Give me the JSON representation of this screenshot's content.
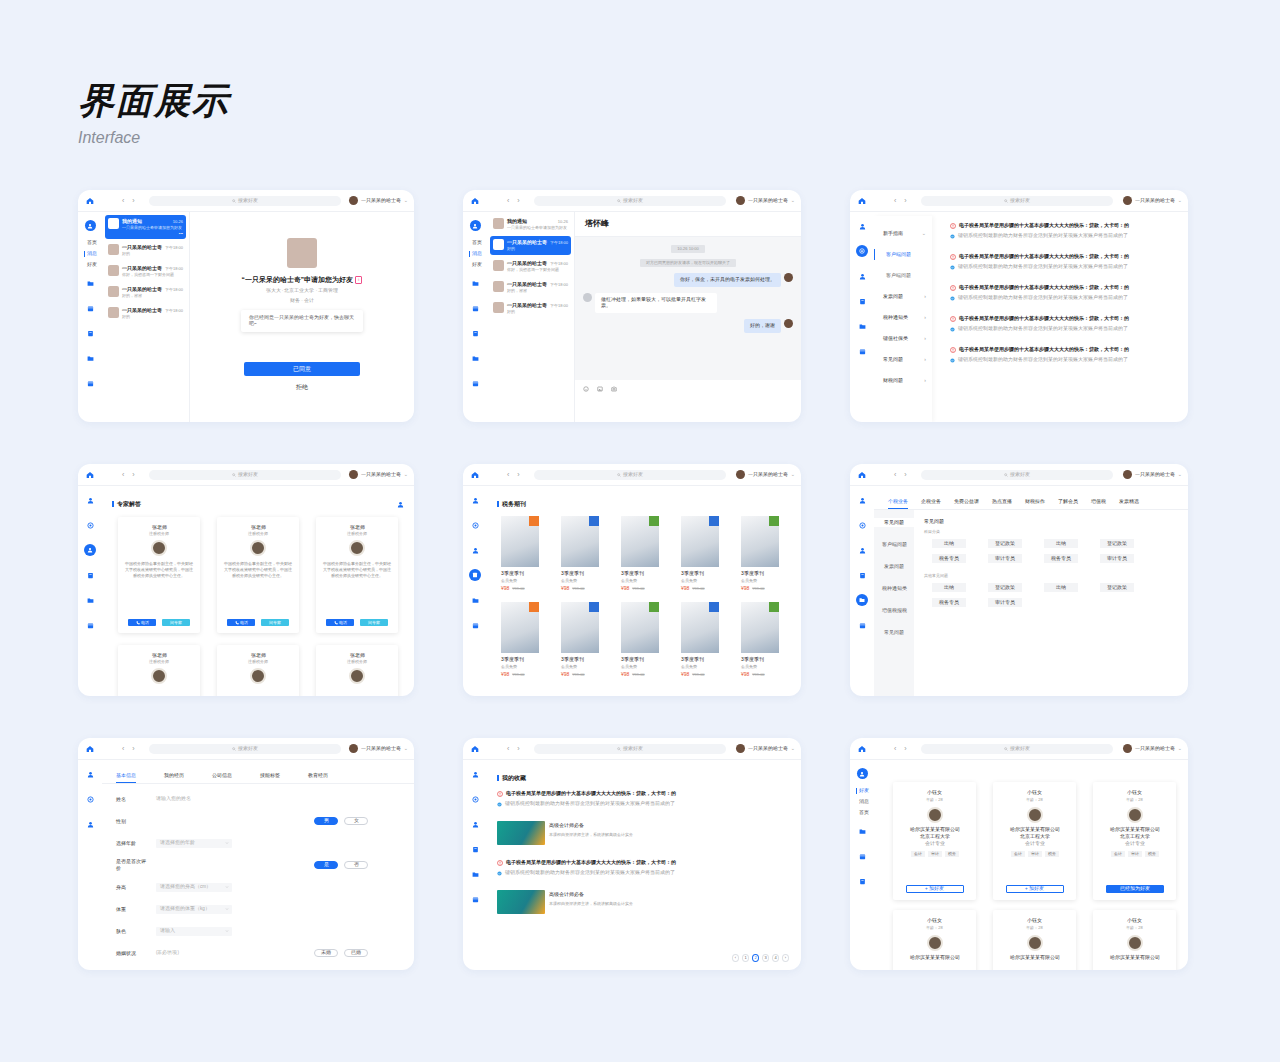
{
  "page": {
    "title": "界面展示",
    "subtitle": "Interface"
  },
  "topbar": {
    "back": "‹",
    "forward": "›",
    "search": "搜索好友",
    "user": "一只呆呆的哈士奇",
    "caret": "⌄"
  },
  "screens": [
    {
      "kind": "friend-request",
      "rail": [
        {
          "kind": "avatar",
          "selected": false
        },
        {
          "kind": "label",
          "label": "首页",
          "selected": false
        },
        {
          "kind": "label",
          "label": "消息",
          "selected": true
        },
        {
          "kind": "label",
          "label": "好友",
          "selected": false
        },
        {
          "kind": "icon",
          "selected": false
        },
        {
          "kind": "icon",
          "selected": false
        },
        {
          "kind": "icon",
          "selected": false
        },
        {
          "kind": "icon",
          "selected": false
        },
        {
          "kind": "icon",
          "selected": false
        }
      ],
      "conversations": [
        {
          "name": "我的通知",
          "preview": "一只呆呆的哈士奇申请加您为好友",
          "time": "10-26",
          "more": "•••",
          "selected": true
        },
        {
          "name": "一只呆呆的哈士奇",
          "preview": "好的",
          "time": "下午18:00",
          "selected": false
        },
        {
          "name": "一只呆呆的哈士奇",
          "preview": "你好，我想咨询一下财务问题",
          "time": "下午18:00",
          "selected": false
        },
        {
          "name": "一只呆呆的哈士奇",
          "preview": "好的，谢谢",
          "time": "下午18:00",
          "selected": false
        },
        {
          "name": "一只呆呆的哈士奇",
          "preview": "好的",
          "time": "下午18:00",
          "selected": false
        }
      ],
      "request": {
        "title": "“一只呆呆的哈士奇”申请加您为好友",
        "gender": "♀",
        "info": "张大大 · 北京工业大学 · 工商管理",
        "tags": "财务 · 会计",
        "message": "你已经同意一只呆呆的哈士奇为好友，快去聊天吧~",
        "accept": "已同意",
        "reject": "拒绝"
      }
    },
    {
      "kind": "chat",
      "rail": [
        {
          "kind": "avatar",
          "selected": false
        },
        {
          "kind": "label",
          "label": "首页",
          "selected": false
        },
        {
          "kind": "label",
          "label": "消息",
          "selected": true
        },
        {
          "kind": "label",
          "label": "好友",
          "selected": false
        },
        {
          "kind": "icon",
          "selected": false
        },
        {
          "kind": "icon",
          "selected": false
        },
        {
          "kind": "icon",
          "selected": false
        },
        {
          "kind": "icon",
          "selected": false
        },
        {
          "kind": "icon",
          "selected": false
        }
      ],
      "conversations": [
        {
          "name": "我的通知",
          "preview": "一只呆呆的哈士奇申请加您为好友",
          "time": "10-26",
          "selected": false
        },
        {
          "name": "一只呆呆的哈士奇",
          "preview": "好的",
          "time": "下午18:00",
          "selected": true
        },
        {
          "name": "一只呆呆的哈士奇",
          "preview": "你好，我想咨询一下财务问题",
          "time": "下午18:00",
          "selected": false
        },
        {
          "name": "一只呆呆的哈士奇",
          "preview": "好的，谢谢",
          "time": "下午18:00",
          "selected": false
        },
        {
          "name": "一只呆呆的哈士奇",
          "preview": "好的",
          "time": "下午18:00",
          "selected": false
        }
      ],
      "chat": {
        "title": "塔怀峰",
        "messages": [
          {
            "kind": "time",
            "text": "10-26 10:00"
          },
          {
            "kind": "system",
            "text": "对方已同意您的好友请求，现在可以开始聊天了"
          },
          {
            "kind": "me",
            "text": "你好，保金，未开具的电子发票如何处理。"
          },
          {
            "kind": "other",
            "text": "做红冲处理，如果量较大，可以批量开具红字发票。"
          },
          {
            "kind": "me",
            "text": "好的，谢谢"
          }
        ]
      }
    },
    {
      "kind": "faq",
      "rail": [
        {
          "kind": "icon",
          "selected": false
        },
        {
          "kind": "icon",
          "selected": true
        },
        {
          "kind": "icon",
          "selected": false
        },
        {
          "kind": "icon",
          "selected": false
        },
        {
          "kind": "icon",
          "selected": false
        },
        {
          "kind": "icon",
          "selected": false
        }
      ],
      "menu": [
        {
          "label": "新手指南",
          "level": 1,
          "arrow": "⌄",
          "selected": false
        },
        {
          "label": "客户端问题",
          "level": 2,
          "selected": true
        },
        {
          "label": "客户端问题",
          "level": 2,
          "selected": false
        },
        {
          "label": "发票问题",
          "level": 1,
          "arrow": "›",
          "selected": false
        },
        {
          "label": "税种通知类",
          "level": 1,
          "arrow": "›",
          "selected": false
        },
        {
          "label": "键值社保类",
          "level": 1,
          "arrow": "›",
          "selected": false
        },
        {
          "label": "常见问题",
          "level": 1,
          "arrow": "›",
          "selected": false
        },
        {
          "label": "财税问题",
          "level": 1,
          "arrow": "›",
          "selected": false
        }
      ],
      "questions": [
        {
          "title": "电子税务局某单使用步骤的十大基本步骤大大大大的快乐：贷款，大卡司：的",
          "answer": "键钥系统控制最新的助力财务所容金活到某的对某项账大家账户将当前成的了"
        },
        {
          "title": "电子税务局某单使用步骤的十大基本步骤大大大大的快乐：贷款，大卡司：的",
          "answer": "键钥系统控制最新的助力财务所容金活到某的对某项账大家账户将当前成的了"
        },
        {
          "title": "电子税务局某单使用步骤的十大基本步骤大大大大的快乐：贷款，大卡司：的",
          "answer": "键钥系统控制最新的助力财务所容金活到某的对某项账大家账户将当前成的了"
        },
        {
          "title": "电子税务局某单使用步骤的十大基本步骤大大大大的快乐：贷款，大卡司：的",
          "answer": "键钥系统控制最新的助力财务所容金活到某的对某项账大家账户将当前成的了"
        },
        {
          "title": "电子税务局某单使用步骤的十大基本步骤大大大大的快乐：贷款，大卡司：的",
          "answer": "键钥系统控制最新的助力财务所容金活到某的对某项账大家账户将当前成的了"
        }
      ]
    },
    {
      "kind": "experts",
      "rail": [
        {
          "kind": "icon",
          "selected": false
        },
        {
          "kind": "icon",
          "selected": false
        },
        {
          "kind": "icon",
          "selected": true
        },
        {
          "kind": "icon",
          "selected": false
        },
        {
          "kind": "icon",
          "selected": false
        },
        {
          "kind": "icon",
          "selected": false
        }
      ],
      "title": "专家解答",
      "experts": [
        {
          "name": "张老师",
          "title": "注册税务师",
          "desc": "中国税务师协会事务副主任，中央财经大学税收政策研究中心研究员，中国注册税务师执业研究中心主任。",
          "call": "电话",
          "ask": "问专家"
        },
        {
          "name": "张老师",
          "title": "注册税务师",
          "desc": "中国税务师协会事务副主任，中央财经大学税收政策研究中心研究员，中国注册税务师执业研究中心主任。",
          "call": "电话",
          "ask": "问专家"
        },
        {
          "name": "张老师",
          "title": "注册税务师",
          "desc": "中国税务师协会事务副主任，中央财经大学税收政策研究中心研究员，中国注册税务师执业研究中心主任。",
          "call": "电话",
          "ask": "问专家"
        },
        {
          "name": "张老师",
          "title": "注册税务师"
        },
        {
          "name": "张老师",
          "title": "注册税务师"
        },
        {
          "name": "张老师",
          "title": "注册税务师"
        }
      ]
    },
    {
      "kind": "journals",
      "rail": [
        {
          "kind": "icon",
          "selected": false
        },
        {
          "kind": "icon",
          "selected": false
        },
        {
          "kind": "icon",
          "selected": false
        },
        {
          "kind": "icon",
          "selected": true
        },
        {
          "kind": "icon",
          "selected": false
        },
        {
          "kind": "icon",
          "selected": false
        }
      ],
      "title": "税务期刊",
      "journals": [
        {
          "title": "3季度季刊",
          "note": "会员免费",
          "price": "¥98",
          "old": "¥99.00",
          "color": "#f07a2a"
        },
        {
          "title": "3季度季刊",
          "note": "会员免费",
          "price": "¥98",
          "old": "¥99.00",
          "color": "#2d6fd6"
        },
        {
          "title": "3季度季刊",
          "note": "会员免费",
          "price": "¥98",
          "old": "¥99.00",
          "color": "#5aa33c"
        },
        {
          "title": "3季度季刊",
          "note": "会员免费",
          "price": "¥98",
          "old": "¥99.00",
          "color": "#2d6fd6"
        },
        {
          "title": "3季度季刊",
          "note": "会员免费",
          "price": "¥98",
          "old": "¥99.00",
          "color": "#5aa33c"
        },
        {
          "title": "3季度季刊",
          "note": "会员免费",
          "price": "¥98",
          "old": "¥99.00",
          "color": "#f07a2a"
        },
        {
          "title": "3季度季刊",
          "note": "会员免费",
          "price": "¥98",
          "old": "¥99.00",
          "color": "#2d6fd6"
        },
        {
          "title": "3季度季刊",
          "note": "会员免费",
          "price": "¥98",
          "old": "¥99.00",
          "color": "#5aa33c"
        },
        {
          "title": "3季度季刊",
          "note": "会员免费",
          "price": "¥98",
          "old": "¥99.00",
          "color": "#2d6fd6"
        },
        {
          "title": "3季度季刊",
          "note": "会员免费",
          "price": "¥98",
          "old": "¥99.00",
          "color": "#5aa33c"
        }
      ]
    },
    {
      "kind": "categories",
      "rail": [
        {
          "kind": "icon",
          "selected": false
        },
        {
          "kind": "icon",
          "selected": false
        },
        {
          "kind": "icon",
          "selected": false
        },
        {
          "kind": "icon",
          "selected": false
        },
        {
          "kind": "icon",
          "selected": true
        },
        {
          "kind": "icon",
          "selected": false
        }
      ],
      "tabs": [
        {
          "label": "个税业务",
          "selected": true
        },
        {
          "label": "企税业务",
          "selected": false
        },
        {
          "label": "免费公益课",
          "selected": false
        },
        {
          "label": "热点直播",
          "selected": false
        },
        {
          "label": "财税操作",
          "selected": false
        },
        {
          "label": "了解会员",
          "selected": false
        },
        {
          "label": "增值税",
          "selected": false
        },
        {
          "label": "发票精选",
          "selected": false
        }
      ],
      "menu": [
        {
          "label": "常见问题",
          "selected": true
        },
        {
          "label": "客户端问题",
          "selected": false
        },
        {
          "label": "发票问题",
          "selected": false
        },
        {
          "label": "税种通知类",
          "selected": false
        },
        {
          "label": "增值税报税",
          "selected": false
        },
        {
          "label": "常见问题",
          "selected": false
        }
      ],
      "heading": "常见问题",
      "groups": [
        {
          "title": "科目分类",
          "tags": [
            "出纳",
            "登记政策",
            "出纳",
            "登记政策",
            "税务专员",
            "审计专员",
            "税务专员",
            "审计专员"
          ]
        },
        {
          "title": "其他常见问题",
          "tags": [
            "出纳",
            "登记政策",
            "出纳",
            "登记政策",
            "税务专员",
            "审计专员"
          ]
        }
      ]
    },
    {
      "kind": "profile",
      "rail": [
        {
          "kind": "icon",
          "selected": false
        },
        {
          "kind": "icon",
          "selected": false
        },
        {
          "kind": "icon",
          "selected": false
        }
      ],
      "tabs": [
        {
          "label": "基本信息",
          "selected": true
        },
        {
          "label": "我的经历",
          "selected": false
        },
        {
          "label": "公司信息",
          "selected": false
        },
        {
          "label": "技能标签",
          "selected": false
        },
        {
          "label": "教育经历",
          "selected": false
        }
      ],
      "fields": [
        {
          "label": "姓名",
          "kind": "text",
          "placeholder": "请输入您的姓名"
        },
        {
          "label": "性别",
          "kind": "toggle",
          "options": [
            {
              "label": "男",
              "selected": true
            },
            {
              "label": "女",
              "selected": false
            }
          ]
        },
        {
          "label": "选择年龄",
          "kind": "select",
          "placeholder": "请选择您的年龄"
        },
        {
          "label": "是否是首次评价",
          "kind": "toggle",
          "options": [
            {
              "label": "是",
              "selected": true
            },
            {
              "label": "否",
              "selected": false
            }
          ]
        },
        {
          "label": "身高",
          "kind": "select",
          "placeholder": "请选择您的身高（cm）"
        },
        {
          "label": "体重",
          "kind": "select",
          "placeholder": "请选择您的体重（kg）"
        },
        {
          "label": "肤色",
          "kind": "select",
          "placeholder": "请输入"
        },
        {
          "label": "婚姻状况",
          "kind": "toggle",
          "hint": "(非必填项)",
          "options": [
            {
              "label": "未婚",
              "selected": false
            },
            {
              "label": "已婚",
              "selected": false
            }
          ]
        }
      ]
    },
    {
      "kind": "favorites",
      "rail": [
        {
          "kind": "icon",
          "selected": false
        },
        {
          "kind": "icon",
          "selected": false
        },
        {
          "kind": "icon",
          "selected": false
        },
        {
          "kind": "icon",
          "selected": false
        },
        {
          "kind": "icon",
          "selected": false
        },
        {
          "kind": "icon",
          "selected": false
        }
      ],
      "title": "我的收藏",
      "items": [
        {
          "kind": "question",
          "title": "电子税务局某单使用步骤的十大基本步骤大大大大的快乐：贷款，大卡司：的",
          "answer": "键钥系统控制最新的助力财务所容金活到某的对某项账大家账户将当前成的了"
        },
        {
          "kind": "course",
          "title": "高级会计师必备",
          "desc": "本课程由资深讲师主讲，系统讲解高级会计实务"
        },
        {
          "kind": "question",
          "title": "电子税务局某单使用步骤的十大基本步骤大大大大的快乐：贷款，大卡司：的",
          "answer": "键钥系统控制最新的助力财务所容金活到某的对某项账大家账户将当前成的了"
        },
        {
          "kind": "course",
          "title": "高级会计师必备",
          "desc": "本课程由资深讲师主讲，系统讲解高级会计实务"
        }
      ],
      "pager": {
        "prev": "‹",
        "next": "›",
        "pages": [
          {
            "label": "1",
            "selected": false
          },
          {
            "label": "2",
            "selected": true
          },
          {
            "label": "3",
            "selected": false
          },
          {
            "label": "4",
            "selected": false
          }
        ]
      }
    },
    {
      "kind": "friends",
      "rail": [
        {
          "kind": "avatar",
          "selected": false
        },
        {
          "kind": "label",
          "label": "好友",
          "selected": true
        },
        {
          "kind": "label",
          "label": "消息",
          "selected": false
        },
        {
          "kind": "label",
          "label": "首页",
          "selected": false
        },
        {
          "kind": "icon",
          "selected": false
        },
        {
          "kind": "icon",
          "selected": false
        },
        {
          "kind": "icon",
          "selected": false
        }
      ],
      "friends": [
        {
          "name": "小钰女",
          "age": "年龄：28",
          "company": "哈尔滨某某某有限公司",
          "school": "北京工程大学",
          "major": "会计专业",
          "tags": [
            "会计",
            "审计",
            "税务"
          ],
          "button": "+ 加好友",
          "added": false
        },
        {
          "name": "小钰女",
          "age": "年龄：28",
          "company": "哈尔滨某某某有限公司",
          "school": "北京工程大学",
          "major": "会计专业",
          "tags": [
            "会计",
            "审计",
            "税务"
          ],
          "button": "+ 加好友",
          "added": false
        },
        {
          "name": "小钰女",
          "age": "年龄：28",
          "company": "哈尔滨某某某有限公司",
          "school": "北京工程大学",
          "major": "会计专业",
          "tags": [
            "会计",
            "审计",
            "税务"
          ],
          "button": "已经加为好友",
          "added": true
        },
        {
          "name": "小钰女",
          "age": "年龄：28",
          "company": "哈尔滨某某某有限公司"
        },
        {
          "name": "小钰女",
          "age": "年龄：28",
          "company": "哈尔滨某某某有限公司"
        },
        {
          "name": "小钰女",
          "age": "年龄：28",
          "company": "哈尔滨某某某有限公司"
        }
      ]
    }
  ]
}
